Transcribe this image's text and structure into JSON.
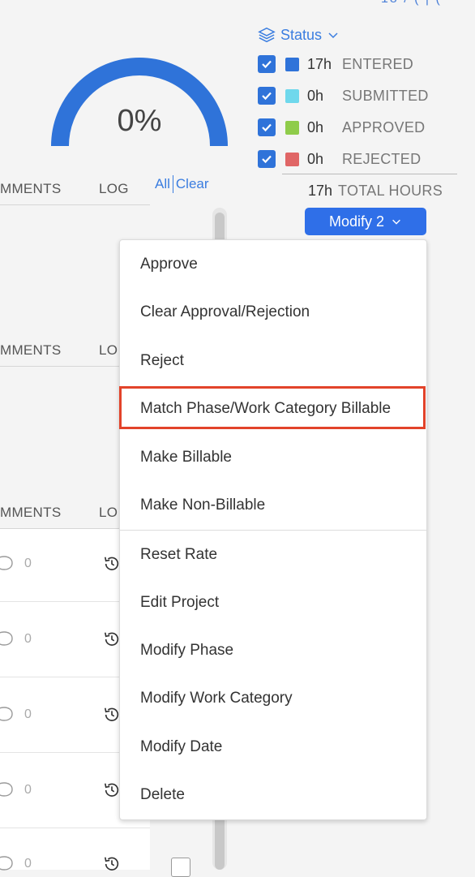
{
  "top_cut_text": "18 / ( | (",
  "gauge": {
    "percent_label": "0%",
    "fill_fraction": 1.0,
    "color": "#2f73d9"
  },
  "status": {
    "title": "Status",
    "items": [
      {
        "hours": "17h",
        "label": "ENTERED",
        "color": "#2f73d9",
        "checked": true
      },
      {
        "hours": "0h",
        "label": "SUBMITTED",
        "color": "#6fd8ec",
        "checked": true
      },
      {
        "hours": "0h",
        "label": "APPROVED",
        "color": "#8fcc4a",
        "checked": true
      },
      {
        "hours": "0h",
        "label": "REJECTED",
        "color": "#e06666",
        "checked": true
      }
    ],
    "total_hours": "17h",
    "total_label": "TOTAL HOURS"
  },
  "modify_button": {
    "label": "Modify 2"
  },
  "filter": {
    "all": "All",
    "clear": "Clear"
  },
  "table": {
    "col_comments": "MMENTS",
    "col_log": "LOG",
    "col_log_cut": "LO",
    "rows": [
      {
        "comment_count": "0"
      },
      {
        "comment_count": "0"
      },
      {
        "comment_count": "0"
      },
      {
        "comment_count": "0"
      },
      {
        "comment_count": "0"
      }
    ]
  },
  "menu": {
    "items": [
      "Approve",
      "Clear Approval/Rejection",
      "Reject",
      "Match Phase/Work Category Billable",
      "Make Billable",
      "Make Non-Billable",
      "Reset Rate",
      "Edit Project",
      "Modify Phase",
      "Modify Work Category",
      "Modify Date",
      "Delete"
    ],
    "highlighted_index": 3,
    "highlight_color": "#e2432a"
  }
}
